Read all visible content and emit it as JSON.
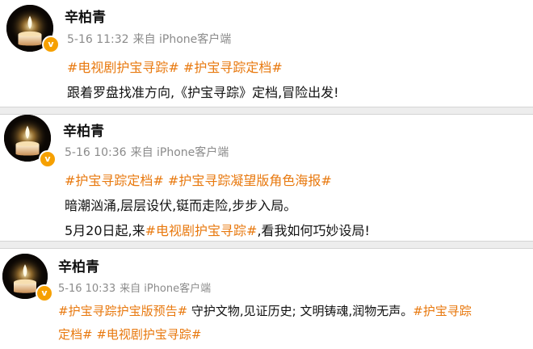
{
  "posts": [
    {
      "author": "辛柏青",
      "verified_badge": "v",
      "date": "5-16 11:32",
      "source": "来自 iPhone客户端",
      "lines": [
        [
          {
            "text": "#电视剧护宝寻踪#",
            "hashtag": true
          },
          {
            "text": " ",
            "hashtag": false
          },
          {
            "text": "#护宝寻踪定档#",
            "hashtag": true
          }
        ],
        [
          {
            "text": "跟着罗盘找准方向,《护宝寻踪》定档,冒险出发!",
            "hashtag": false
          }
        ]
      ]
    },
    {
      "author": "辛柏青",
      "verified_badge": "v",
      "date": "5-16 10:36",
      "source": "来自 iPhone客户端",
      "lines": [
        [
          {
            "text": "#护宝寻踪定档#",
            "hashtag": true
          },
          {
            "text": " ",
            "hashtag": false
          },
          {
            "text": "#护宝寻踪凝望版角色海报#",
            "hashtag": true
          }
        ],
        [
          {
            "text": "暗潮汹涌,层层设伏,铤而走险,步步入局。",
            "hashtag": false
          }
        ],
        [
          {
            "text": "5月20日起,来",
            "hashtag": false
          },
          {
            "text": "#电视剧护宝寻踪#",
            "hashtag": true
          },
          {
            "text": ",看我如何巧妙设局!",
            "hashtag": false
          }
        ]
      ]
    },
    {
      "author": "辛柏青",
      "verified_badge": "v",
      "date": "5-16 10:33",
      "source": "来自 iPhone客户端",
      "lines": [
        [
          {
            "text": "#护宝寻踪护宝版预告#",
            "hashtag": true
          },
          {
            "text": " 守护文物,见证历史; 文明铸魂,润物无声。",
            "hashtag": false
          },
          {
            "text": "#护宝寻踪",
            "hashtag": true
          }
        ],
        [
          {
            "text": "定档#",
            "hashtag": true
          },
          {
            "text": " ",
            "hashtag": false
          },
          {
            "text": "#电视剧护宝寻踪#",
            "hashtag": true
          }
        ]
      ]
    }
  ],
  "colors": {
    "hashtag": "#e8790f",
    "meta": "#8b8b8b",
    "badge": "#f6a000"
  },
  "icons": {
    "avatar": "candle-avatar-icon",
    "badge": "verified-badge-icon"
  }
}
